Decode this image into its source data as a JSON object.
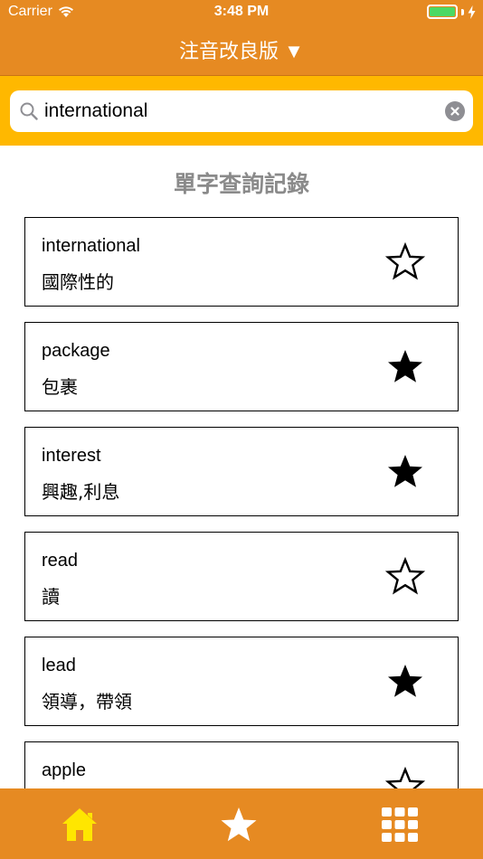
{
  "status_bar": {
    "carrier": "Carrier",
    "time": "3:48 PM",
    "battery_level": 1.0
  },
  "nav": {
    "title": "注音改良版 ▼"
  },
  "search": {
    "value": "international",
    "icon": "search-icon",
    "clear_icon": "clear-icon"
  },
  "history": {
    "title": "單字查詢記錄",
    "items": [
      {
        "word": "international",
        "meaning": "國際性的",
        "favorited": false
      },
      {
        "word": "package",
        "meaning": "包裹",
        "favorited": true
      },
      {
        "word": "interest",
        "meaning": "興趣,利息",
        "favorited": true
      },
      {
        "word": "read",
        "meaning": "讀",
        "favorited": false
      },
      {
        "word": "lead",
        "meaning": "領導，帶領",
        "favorited": true
      },
      {
        "word": "apple",
        "meaning": "",
        "favorited": false
      }
    ]
  },
  "tab_bar": {
    "tabs": [
      {
        "icon": "home-icon",
        "active": true
      },
      {
        "icon": "star-icon",
        "active": false
      },
      {
        "icon": "grid-icon",
        "active": false
      }
    ]
  },
  "colors": {
    "nav": "#e68a22",
    "search_area": "#ffb800",
    "active_tab": "#ffe600",
    "inactive_tab": "#ffffff"
  }
}
